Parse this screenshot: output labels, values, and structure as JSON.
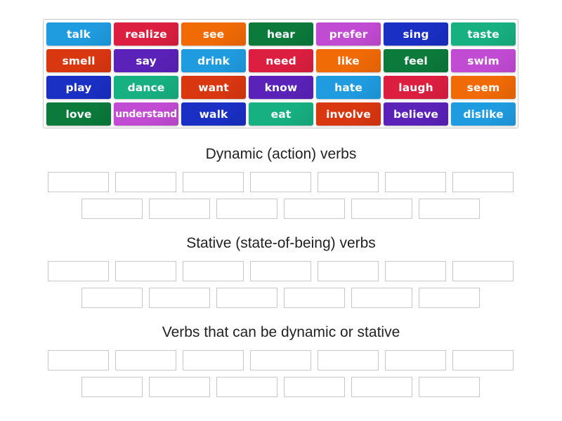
{
  "colors": {
    "blue": "#1f9ce0",
    "red": "#dc1f40",
    "orange": "#f06a05",
    "green": "#0b7a3b",
    "magenta": "#c24bd3",
    "navy": "#1a2fc4",
    "teal": "#17b080",
    "vermilion": "#d93710",
    "purple": "#5a22b8"
  },
  "tiles": [
    {
      "label": "talk",
      "color": "blue"
    },
    {
      "label": "realize",
      "color": "red"
    },
    {
      "label": "see",
      "color": "orange"
    },
    {
      "label": "hear",
      "color": "green"
    },
    {
      "label": "prefer",
      "color": "magenta"
    },
    {
      "label": "sing",
      "color": "navy"
    },
    {
      "label": "taste",
      "color": "teal"
    },
    {
      "label": "smell",
      "color": "vermilion"
    },
    {
      "label": "say",
      "color": "purple"
    },
    {
      "label": "drink",
      "color": "blue"
    },
    {
      "label": "need",
      "color": "red"
    },
    {
      "label": "like",
      "color": "orange"
    },
    {
      "label": "feel",
      "color": "green"
    },
    {
      "label": "swim",
      "color": "magenta"
    },
    {
      "label": "play",
      "color": "navy"
    },
    {
      "label": "dance",
      "color": "teal"
    },
    {
      "label": "want",
      "color": "vermilion"
    },
    {
      "label": "know",
      "color": "purple"
    },
    {
      "label": "hate",
      "color": "blue"
    },
    {
      "label": "laugh",
      "color": "red"
    },
    {
      "label": "seem",
      "color": "orange"
    },
    {
      "label": "love",
      "color": "green"
    },
    {
      "label": "understand",
      "color": "magenta"
    },
    {
      "label": "walk",
      "color": "navy"
    },
    {
      "label": "eat",
      "color": "teal"
    },
    {
      "label": "involve",
      "color": "vermilion"
    },
    {
      "label": "believe",
      "color": "purple"
    },
    {
      "label": "dislike",
      "color": "blue"
    }
  ],
  "groups": [
    {
      "title": "Dynamic (action) verbs",
      "slot_count": 13
    },
    {
      "title": "Stative (state-of-being) verbs",
      "slot_count": 13
    },
    {
      "title": "Verbs that can be dynamic or stative",
      "slot_count": 13
    }
  ]
}
